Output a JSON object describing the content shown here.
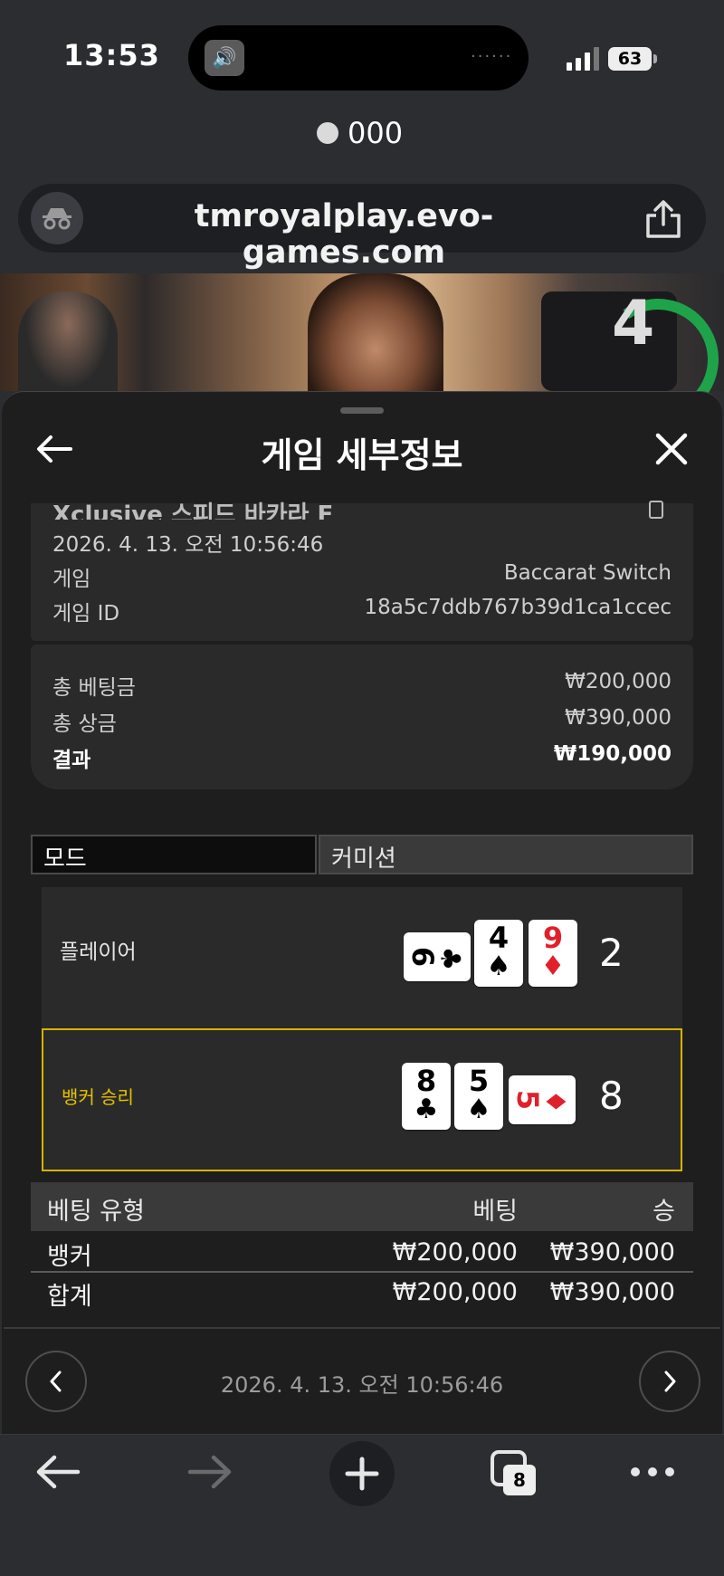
{
  "status_bar": {
    "time": "13:53",
    "battery": "63",
    "speaker_icon": "speaker-icon",
    "signal_icon": "signal-icon"
  },
  "recorder": {
    "label": "000"
  },
  "browser": {
    "url": "tmroyalplay.evo-games.com",
    "tab_count": "8"
  },
  "video": {
    "countdown": "4"
  },
  "panel": {
    "title": "게임 세부정보",
    "game_title": "Xclusive 스피드 바카라 F",
    "datetime": "2026. 4. 13. 오전 10:56:46",
    "info_rows": [
      {
        "label": "게임",
        "value": "Baccarat Switch"
      },
      {
        "label": "게임 ID",
        "value": "18a5c7ddb767b39d1ca1ccec"
      }
    ],
    "totals": [
      {
        "label": "총 베팅금",
        "value": "₩200,000"
      },
      {
        "label": "총 상금",
        "value": "₩390,000"
      },
      {
        "label": "결과",
        "value": "₩190,000"
      }
    ],
    "mode_label": "모드",
    "commission_label": "커미션",
    "player": {
      "label": "플레이어",
      "score": "2",
      "cards": [
        {
          "rank": "6",
          "suit": "♣",
          "color": "#000000",
          "orientation": "sideways"
        },
        {
          "rank": "4",
          "suit": "♠",
          "color": "#000000",
          "orientation": "upright"
        },
        {
          "rank": "9",
          "suit": "♦",
          "color": "#e0202a",
          "orientation": "upright"
        }
      ]
    },
    "banker": {
      "label": "뱅커 승리",
      "score": "8",
      "cards": [
        {
          "rank": "8",
          "suit": "♣",
          "color": "#000000",
          "orientation": "upright"
        },
        {
          "rank": "5",
          "suit": "♠",
          "color": "#000000",
          "orientation": "upright"
        },
        {
          "rank": "5",
          "suit": "♦",
          "color": "#e0202a",
          "orientation": "sideways"
        }
      ]
    },
    "bet_table": {
      "headers": [
        "베팅 유형",
        "베팅",
        "승"
      ],
      "rows": [
        [
          "뱅커",
          "₩200,000",
          "₩390,000"
        ],
        [
          "합계",
          "₩200,000",
          "₩390,000"
        ]
      ]
    },
    "footer_datetime": "2026. 4. 13. 오전 10:56:46"
  },
  "colors": {
    "highlight": "#d6b200",
    "timer": "#1fa34a",
    "panel_bg": "#1e1e1e"
  }
}
